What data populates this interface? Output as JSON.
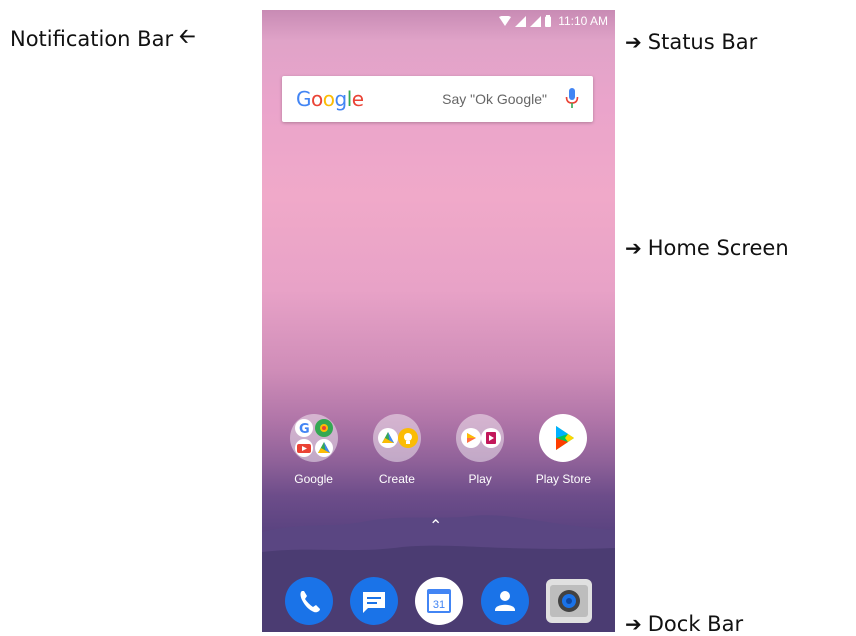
{
  "annotations": {
    "notification": "Notification Bar",
    "status": "Status Bar",
    "home": "Home Screen",
    "dock": "Dock Bar"
  },
  "status_bar": {
    "time": "11:10 AM",
    "icons": [
      "wifi-icon",
      "signal-icon",
      "signal-icon",
      "battery-icon"
    ]
  },
  "search": {
    "logo": [
      "G",
      "o",
      "o",
      "g",
      "l",
      "e"
    ],
    "hint": "Say \"Ok Google\"",
    "icon": "mic-icon"
  },
  "apps": [
    {
      "label": "Google",
      "icon": "google-folder-icon"
    },
    {
      "label": "Create",
      "icon": "create-folder-icon"
    },
    {
      "label": "Play",
      "icon": "play-folder-icon"
    },
    {
      "label": "Play Store",
      "icon": "play-store-icon"
    }
  ],
  "dock": [
    {
      "icon": "phone-icon"
    },
    {
      "icon": "messages-icon"
    },
    {
      "icon": "calendar-icon",
      "text": "31"
    },
    {
      "icon": "contacts-icon"
    },
    {
      "icon": "camera-icon"
    }
  ],
  "colors": {
    "google_blue": "#4285F4",
    "google_red": "#EA4335",
    "google_yellow": "#FBBC05",
    "google_green": "#34A853",
    "dock_blue": "#1a73e8"
  }
}
